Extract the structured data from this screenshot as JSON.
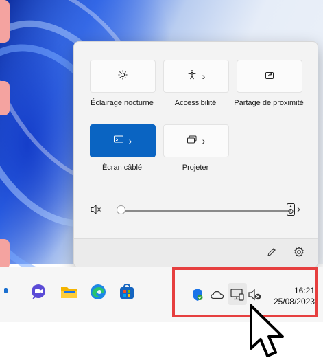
{
  "quick_settings": {
    "tiles": [
      {
        "id": "night-light",
        "label": "Éclairage nocturne",
        "icon": "brightness-icon",
        "has_chevron": false,
        "active": false
      },
      {
        "id": "accessibility",
        "label": "Accessibilité",
        "icon": "accessibility-icon",
        "has_chevron": true,
        "active": false
      },
      {
        "id": "nearby-sharing",
        "label": "Partage de proximité",
        "icon": "share-icon",
        "has_chevron": false,
        "active": false
      },
      {
        "id": "wired-display",
        "label": "Écran câblé",
        "icon": "cast-icon",
        "has_chevron": true,
        "active": true
      },
      {
        "id": "project",
        "label": "Projeter",
        "icon": "project-icon",
        "has_chevron": true,
        "active": false
      }
    ],
    "chevron": "›",
    "volume": {
      "muted": true,
      "level": 0,
      "output_icon": "speaker-device-icon",
      "chevron": "›"
    },
    "footer": {
      "edit_icon": "pencil-icon",
      "settings_icon": "gear-icon"
    }
  },
  "taskbar": {
    "apps": [
      "chat-icon",
      "file-explorer-icon",
      "edge-icon",
      "store-icon"
    ],
    "tray": [
      "defender-icon",
      "onedrive-icon",
      "network-display-icon",
      "speaker-muted-icon"
    ],
    "time": "16:21",
    "date": "25/08/2023"
  },
  "colors": {
    "accent": "#0a64c2",
    "highlight": "#e63f3f"
  }
}
